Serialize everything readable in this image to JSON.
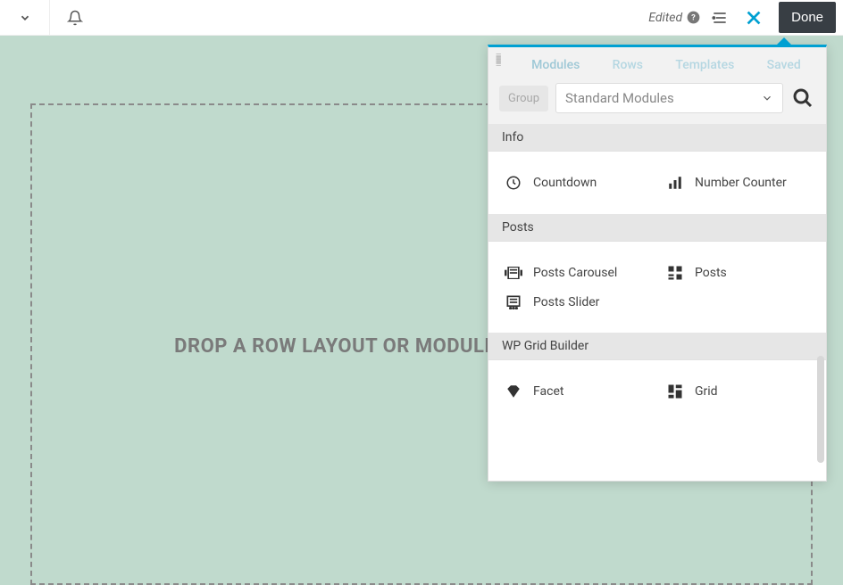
{
  "topbar": {
    "edited_label": "Edited",
    "done_label": "Done"
  },
  "canvas": {
    "drop_text": "DROP A ROW LAYOUT OR MODULE TO GET STARTED!"
  },
  "panel": {
    "tabs": [
      "Modules",
      "Rows",
      "Templates",
      "Saved"
    ],
    "group_label": "Group",
    "dropdown_value": "Standard Modules",
    "sections": [
      {
        "title": "Info",
        "items": [
          {
            "icon": "clock",
            "label": "Countdown"
          },
          {
            "icon": "bars",
            "label": "Number Counter"
          }
        ]
      },
      {
        "title": "Posts",
        "items": [
          {
            "icon": "carousel",
            "label": "Posts Carousel"
          },
          {
            "icon": "grid3",
            "label": "Posts"
          },
          {
            "icon": "slider",
            "label": "Posts Slider"
          }
        ]
      },
      {
        "title": "WP Grid Builder",
        "items": [
          {
            "icon": "diamond",
            "label": "Facet"
          },
          {
            "icon": "grid2",
            "label": "Grid"
          }
        ]
      }
    ]
  }
}
